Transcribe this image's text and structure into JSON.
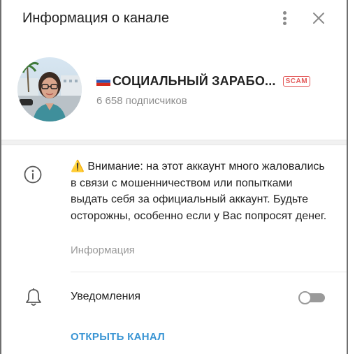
{
  "header": {
    "title": "Информация о канале",
    "menu_icon": "kebab-menu-icon",
    "close_icon": "close-icon"
  },
  "profile": {
    "flag": "🇷🇺",
    "name": "СОЦИАЛЬНЫЙ ЗАРАБО...",
    "badge": "SCAM",
    "subscribers": "6 658 подписчиков"
  },
  "info": {
    "warning_icon": "⚠️",
    "warning_text": "Внимание: на этот аккаунт много жаловались в связи с мошенничеством или попытками выдать себя за официальный аккаунт. Будьте осторожны, особенно если у Вас попросят денег.",
    "label": "Информация"
  },
  "notifications": {
    "label": "Уведомления",
    "enabled": false
  },
  "actions": {
    "open_channel": "ОТКРЫТЬ КАНАЛ"
  },
  "colors": {
    "accent": "#3a95d4",
    "scam": "#e35a5a",
    "muted": "#8e8e8e"
  }
}
